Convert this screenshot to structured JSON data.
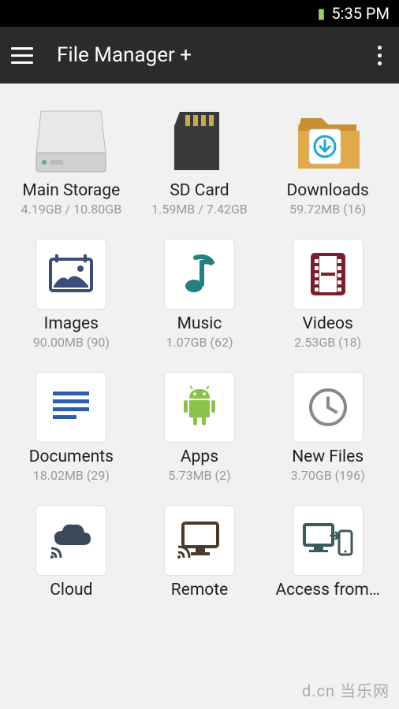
{
  "statusbar": {
    "time": "5:35 PM"
  },
  "appbar": {
    "title": "File Manager +"
  },
  "grid": {
    "main_storage": {
      "label": "Main Storage",
      "sub": "4.19GB / 10.80GB"
    },
    "sd_card": {
      "label": "SD Card",
      "sub": "1.59MB / 7.42GB"
    },
    "downloads": {
      "label": "Downloads",
      "sub": "59.72MB (16)"
    },
    "images": {
      "label": "Images",
      "sub": "90.00MB (90)"
    },
    "music": {
      "label": "Music",
      "sub": "1.07GB (62)"
    },
    "videos": {
      "label": "Videos",
      "sub": "2.53GB (18)"
    },
    "documents": {
      "label": "Documents",
      "sub": "18.02MB (29)"
    },
    "apps": {
      "label": "Apps",
      "sub": "5.73MB (2)"
    },
    "new_files": {
      "label": "New Files",
      "sub": "3.70GB (196)"
    },
    "cloud": {
      "label": "Cloud",
      "sub": ""
    },
    "remote": {
      "label": "Remote",
      "sub": ""
    },
    "access": {
      "label": "Access from…",
      "sub": ""
    }
  },
  "watermark": "d.cn 当乐网"
}
